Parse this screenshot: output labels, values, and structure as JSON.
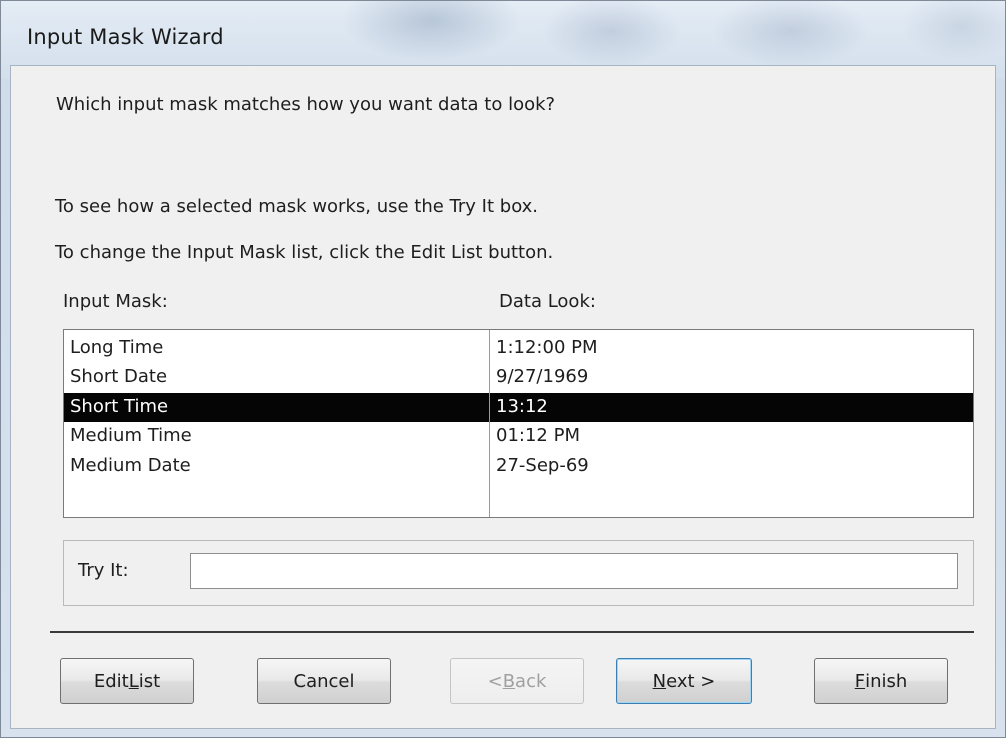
{
  "window": {
    "title": "Input Mask Wizard"
  },
  "wizard": {
    "question": "Which input mask matches how you want data to look?",
    "hint_try": "To see how a selected mask works, use the Try It box.",
    "hint_edit": "To change the Input Mask list, click the Edit List button.",
    "columns": {
      "mask": "Input Mask:",
      "look": "Data Look:"
    },
    "rows": [
      {
        "mask": "Long Time",
        "look": "1:12:00 PM",
        "selected": false
      },
      {
        "mask": "Short Date",
        "look": "9/27/1969",
        "selected": false
      },
      {
        "mask": "Short Time",
        "look": "13:12",
        "selected": true
      },
      {
        "mask": "Medium Time",
        "look": "01:12 PM",
        "selected": false
      },
      {
        "mask": "Medium Date",
        "look": "27-Sep-69",
        "selected": false
      }
    ],
    "try_it": {
      "label": "Try It:",
      "value": "",
      "placeholder": ""
    }
  },
  "buttons": {
    "edit_list": {
      "pre": "Edit ",
      "key": "L",
      "post": "ist"
    },
    "cancel": {
      "label": "Cancel"
    },
    "back": {
      "pre": "< ",
      "key": "B",
      "post": "ack",
      "disabled": true
    },
    "next": {
      "pre": "",
      "key": "N",
      "post": "ext >",
      "default": true
    },
    "finish": {
      "pre": "",
      "key": "F",
      "post": "inish"
    }
  },
  "colors": {
    "selection_background": "#050505",
    "selection_text": "#ffffff",
    "default_button_border": "#3c7fb1"
  }
}
